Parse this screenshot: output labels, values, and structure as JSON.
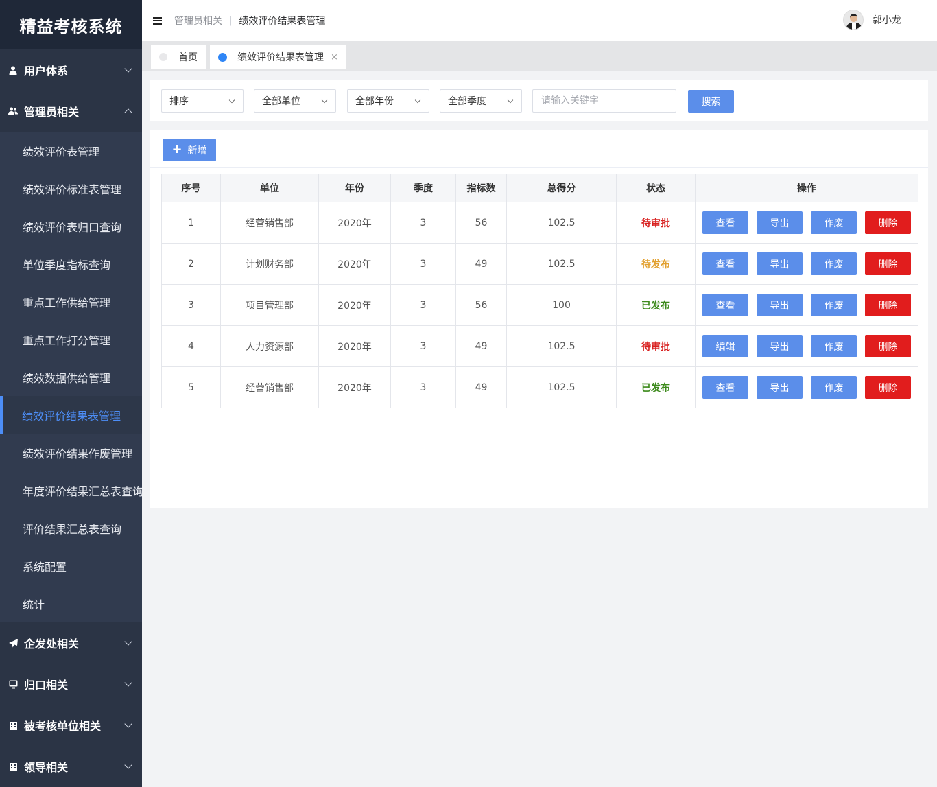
{
  "app": {
    "title": "精益考核系统"
  },
  "sidebar": {
    "groups": [
      {
        "label": "用户体系",
        "icon": "user-icon"
      },
      {
        "label": "管理员相关",
        "icon": "users-icon",
        "items": [
          "绩效评价表管理",
          "绩效评价标准表管理",
          "绩效评价表归口查询",
          "单位季度指标查询",
          "重点工作供给管理",
          "重点工作打分管理",
          "绩效数据供给管理",
          "绩效评价结果表管理",
          "绩效评价结果作废管理",
          "年度评价结果汇总表查询",
          "评价结果汇总表查询",
          "系统配置",
          "统计"
        ],
        "active_item": "绩效评价结果表管理"
      },
      {
        "label": "企发处相关",
        "icon": "paper-plane-icon"
      },
      {
        "label": "归口相关",
        "icon": "monitor-icon"
      },
      {
        "label": "被考核单位相关",
        "icon": "building-icon"
      },
      {
        "label": "领导相关",
        "icon": "building-icon"
      }
    ]
  },
  "header": {
    "breadcrumb_parent": "管理员相关",
    "breadcrumb_separator": "|",
    "breadcrumb_current": "绩效评价结果表管理",
    "user_name": "郭小龙"
  },
  "tabs": [
    {
      "label": "首页",
      "active": false
    },
    {
      "label": "绩效评价结果表管理",
      "active": true,
      "close": "×"
    }
  ],
  "filters": {
    "sort": "排序",
    "unit": "全部单位",
    "year": "全部年份",
    "quarter": "全部季度",
    "keyword_placeholder": "请输入关键字",
    "search_label": "搜索"
  },
  "toolbar": {
    "add_label": "新增",
    "add_icon": "plus-icon"
  },
  "table": {
    "headers": [
      "序号",
      "单位",
      "年份",
      "季度",
      "指标数",
      "总得分",
      "状态",
      "操作"
    ],
    "rows": [
      {
        "no": "1",
        "unit": "经营销售部",
        "year": "2020年",
        "quarter": "3",
        "count": "56",
        "score": "102.5",
        "status": "待审批",
        "status_type": "pending",
        "view": "查看",
        "export": "导出",
        "void": "作废",
        "delete": "删除"
      },
      {
        "no": "2",
        "unit": "计划财务部",
        "year": "2020年",
        "quarter": "3",
        "count": "49",
        "score": "102.5",
        "status": "待发布",
        "status_type": "wait",
        "view": "查看",
        "export": "导出",
        "void": "作废",
        "delete": "删除"
      },
      {
        "no": "3",
        "unit": "项目管理部",
        "year": "2020年",
        "quarter": "3",
        "count": "56",
        "score": "100",
        "status": "已发布",
        "status_type": "pub",
        "view": "查看",
        "export": "导出",
        "void": "作废",
        "delete": "删除"
      },
      {
        "no": "4",
        "unit": "人力资源部",
        "year": "2020年",
        "quarter": "3",
        "count": "49",
        "score": "102.5",
        "status": "待审批",
        "status_type": "pending",
        "view": "编辑",
        "export": "导出",
        "void": "作废",
        "delete": "删除"
      },
      {
        "no": "5",
        "unit": "经营销售部",
        "year": "2020年",
        "quarter": "3",
        "count": "49",
        "score": "102.5",
        "status": "已发布",
        "status_type": "pub",
        "view": "查看",
        "export": "导出",
        "void": "作废",
        "delete": "删除"
      }
    ]
  },
  "colors": {
    "sidebar_bg": "#2b3445",
    "logo_bg": "#1f2838",
    "accent": "#5b8eea",
    "active_menu": "#4d8ef7",
    "danger": "#e11d1d",
    "status_pending": "#d8201f",
    "status_wait": "#e2a02e",
    "status_published": "#3d8a1c"
  }
}
